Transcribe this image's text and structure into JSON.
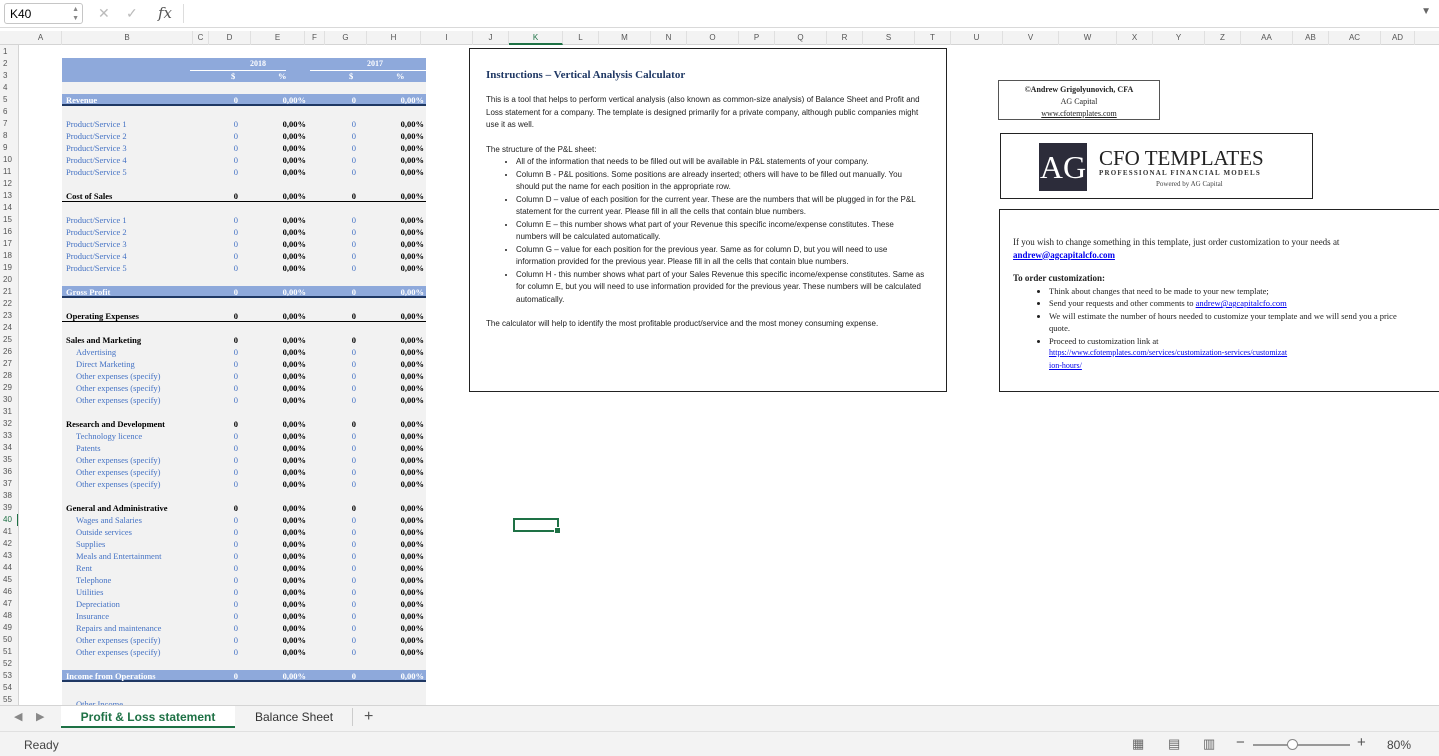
{
  "namebox": "K40",
  "columns": [
    "A",
    "B",
    "C",
    "D",
    "E",
    "F",
    "G",
    "H",
    "I",
    "J",
    "K",
    "L",
    "M",
    "N",
    "O",
    "P",
    "Q",
    "R",
    "S",
    "T",
    "U",
    "V",
    "W",
    "X",
    "Y",
    "Z",
    "AA",
    "AB",
    "AC",
    "AD"
  ],
  "table": {
    "year1": "2018",
    "year2": "2017",
    "cur": "$",
    "pct": "%",
    "revenue": {
      "label": "Revenue",
      "v1": "0",
      "p1": "0,00%",
      "v2": "0",
      "p2": "0,00%"
    },
    "rev_items": [
      "Product/Service 1",
      "Product/Service 2",
      "Product/Service 3",
      "Product/Service 4",
      "Product/Service 5"
    ],
    "cogs": {
      "label": "Cost of Sales",
      "v1": "0",
      "p1": "0,00%",
      "v2": "0",
      "p2": "0,00%"
    },
    "gross": {
      "label": "Gross Profit",
      "v1": "0",
      "p1": "0,00%",
      "v2": "0",
      "p2": "0,00%"
    },
    "opex": {
      "label": "Operating Expenses",
      "v1": "0",
      "p1": "0,00%",
      "v2": "0",
      "p2": "0,00%"
    },
    "sm": {
      "label": "Sales and Marketing",
      "items": [
        "Advertising",
        "Direct Marketing",
        "Other expenses (specify)",
        "Other expenses (specify)",
        "Other expenses (specify)"
      ]
    },
    "rd": {
      "label": "Research and Development",
      "items": [
        "Technology licence",
        "Patents",
        "Other expenses (specify)",
        "Other expenses (specify)",
        "Other expenses (specify)"
      ]
    },
    "ga": {
      "label": "General and Administrative",
      "items": [
        "Wages and Salaries",
        "Outside services",
        "Supplies",
        "Meals and Entertainment",
        "Rent",
        "Telephone",
        "Utilities",
        "Depreciation",
        "Insurance",
        "Repairs and maintenance",
        "Other expenses (specify)",
        "Other expenses (specify)"
      ]
    },
    "ifo": {
      "label": "Income from Operations",
      "v1": "0",
      "p1": "0,00%",
      "v2": "0",
      "p2": "0,00%"
    },
    "other_income": "Other Income",
    "zero": "0",
    "zpct": "0,00%"
  },
  "instructions": {
    "title": "Instructions – Vertical Analysis Calculator",
    "intro": "This is a tool that helps to perform vertical analysis (also known as common-size analysis) of Balance Sheet and Profit and Loss statement for a company. The template is designed primarily for a private company, although public companies might use it as well.",
    "structure": "The structure of the P&L sheet:",
    "bullets": [
      "All of the information that needs to be filled out will be available in P&L statements of your company.",
      "Column B - P&L positions. Some positions are already inserted; others will have to be filled out manually. You should put the name for each position in the appropriate row.",
      "Column D – value of each position for the current year. These are the numbers that will be plugged in for the P&L statement for the current year. Please fill in all the cells that contain blue numbers.",
      "Column E – this number shows what part of your Revenue this specific income/expense constitutes. These numbers will be calculated automatically.",
      "Column G – value for each position for the previous year. Same as for column D, but you will need to use information provided for the previous year. Please fill in all the cells that contain blue numbers.",
      "Column H - this number shows what part of your Sales Revenue this specific income/expense constitutes.  Same as for column E, but you will need to use information provided for the previous year. These numbers will be calculated automatically."
    ],
    "footer": "The calculator will help to identify the most profitable product/service and the most money consuming expense."
  },
  "credit": {
    "author": "©Andrew Grigolyunovich, CFA",
    "company": "AG Capital",
    "link": "www.cfotemplates.com"
  },
  "logo": {
    "mark": "AG",
    "name": "CFO TEMPLATES",
    "tagline": "PROFESSIONAL FINANCIAL MODELS",
    "powered": "Powered by AG Capital"
  },
  "custom": {
    "line1": "If you wish to change something in this template, just order customization to your needs at ",
    "email": "andrew@agcapitalcfo.com",
    "heading": "To order customization",
    "b1": "Think about changes that need to be made to your new template;",
    "b2": "Send your requests and other comments to ",
    "b3": "We will estimate the number of hours needed to customize your template and we will send you a price quote.",
    "b4": "Proceed to customization link at",
    "url": "https://www.cfotemplates.com/services/customization-services/customization-hours/"
  },
  "tabs": [
    "Profit & Loss statement",
    "Balance Sheet"
  ],
  "status": "Ready",
  "zoom": "80%"
}
